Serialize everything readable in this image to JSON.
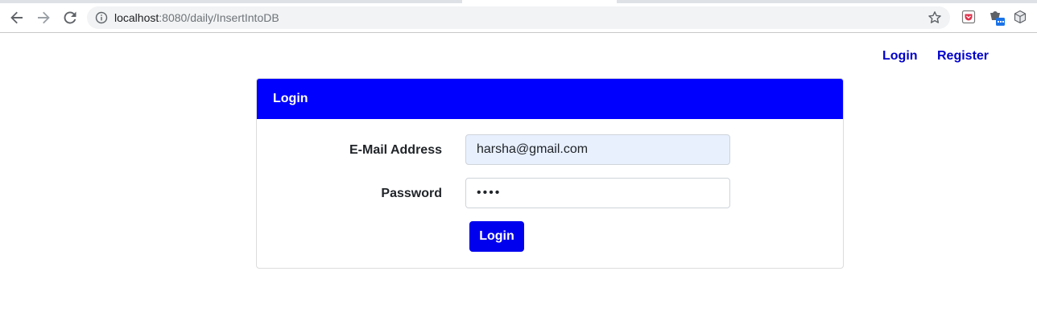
{
  "browser": {
    "url_host": "localhost",
    "url_rest": ":8080/daily/InsertIntoDB",
    "icons": {
      "back": "back-arrow-icon",
      "forward": "forward-arrow-icon",
      "reload": "reload-icon",
      "site_info": "info-icon",
      "bookmark": "star-icon",
      "extension_1": "pocket-icon",
      "extension_2": "calendar-extension-icon",
      "extension_3": "cube-icon"
    }
  },
  "nav": {
    "login_label": "Login",
    "register_label": "Register"
  },
  "card": {
    "title": "Login",
    "header_color": "#0000ff"
  },
  "form": {
    "email_label": "E-Mail Address",
    "email_value": "harsha@gmail.com",
    "password_label": "Password",
    "password_value": "1234",
    "submit_label": "Login"
  }
}
